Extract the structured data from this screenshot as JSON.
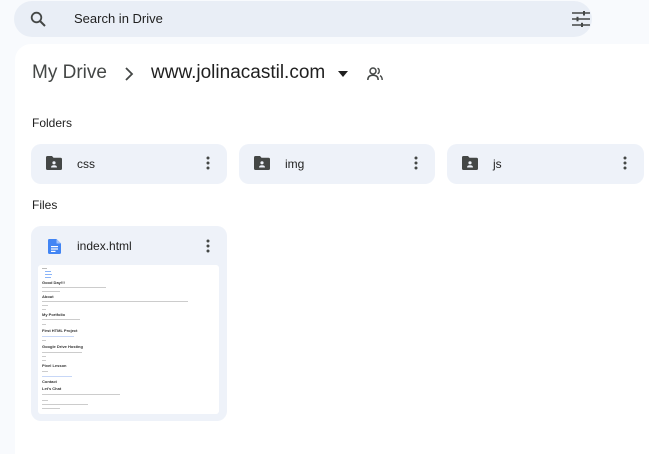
{
  "search": {
    "placeholder": "Search in Drive",
    "icon": "search-icon",
    "options_icon": "tune-icon"
  },
  "breadcrumb": {
    "root": "My Drive",
    "current": "www.jolinacastil.com"
  },
  "sections": {
    "folders": "Folders",
    "files": "Files"
  },
  "folders": [
    {
      "name": "css"
    },
    {
      "name": "img"
    },
    {
      "name": "js"
    }
  ],
  "files": [
    {
      "name": "index.html",
      "preview_headings": [
        "Good Day!!!",
        "About",
        "My Portfolio",
        "First HTML Project",
        "Google Drive Hosting",
        "Pixel Lesson",
        "Contact",
        "Let's Chat"
      ]
    }
  ],
  "colors": {
    "accent": "#1a73e8",
    "folder_bg": "#eef2f9",
    "search_bg": "#e9eef6"
  }
}
